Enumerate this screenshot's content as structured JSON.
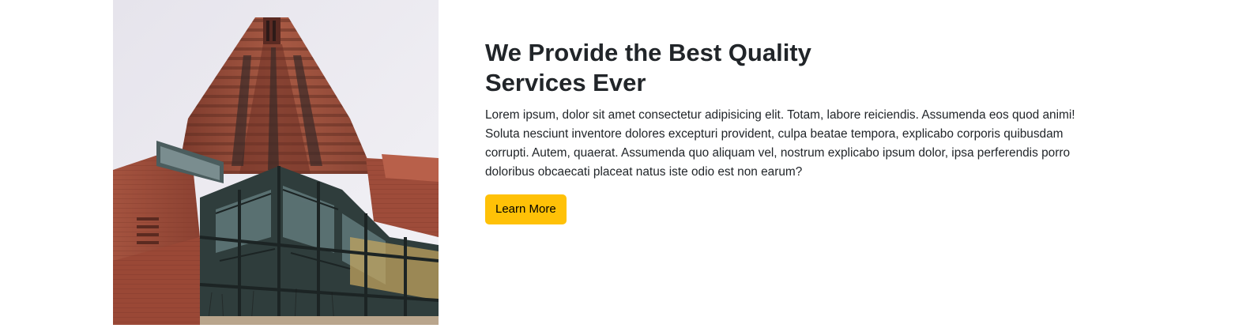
{
  "feature": {
    "image_subject": "building-photo",
    "title": "We Provide the Best Quality Services Ever",
    "body": "Lorem ipsum, dolor sit amet consectetur adipisicing elit. Totam, labore reiciendis. Assumenda eos quod animi! Soluta nesciunt inventore dolores excepturi provident, culpa beatae tempora, explicabo corporis quibusdam corrupti. Autem, quaerat. Assumenda quo aliquam vel, nostrum explicabo ipsum dolor, ipsa perferendis porro doloribus obcaecati placeat natus iste odio est non earum?",
    "button_label": "Learn More"
  },
  "colors": {
    "accent": "#ffc107",
    "text": "#212529",
    "brick": "#9a4a36",
    "glass": "#3a4a4a"
  }
}
